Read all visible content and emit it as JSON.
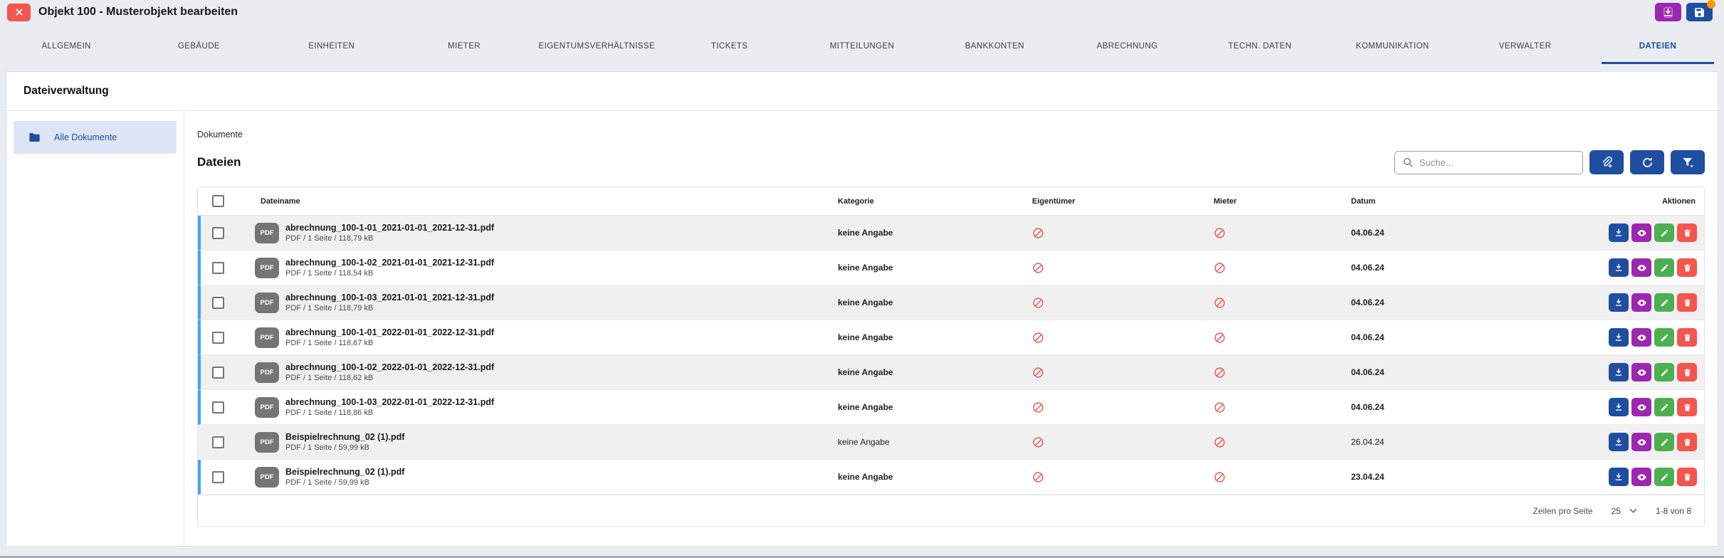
{
  "window": {
    "title": "Objekt 100 - Musterobjekt bearbeiten"
  },
  "topbar": {
    "buttons": [
      "import",
      "save"
    ],
    "save_has_notification": true
  },
  "tabs": [
    {
      "label": "ALLGEMEIN",
      "active": false
    },
    {
      "label": "GEBÄUDE",
      "active": false
    },
    {
      "label": "EINHEITEN",
      "active": false
    },
    {
      "label": "MIETER",
      "active": false
    },
    {
      "label": "EIGENTUMSVERHÄLTNISSE",
      "active": false
    },
    {
      "label": "TICKETS",
      "active": false
    },
    {
      "label": "MITTEILUNGEN",
      "active": false
    },
    {
      "label": "BANKKONTEN",
      "active": false
    },
    {
      "label": "ABRECHNUNG",
      "active": false
    },
    {
      "label": "TECHN. DATEN",
      "active": false
    },
    {
      "label": "KOMMUNIKATION",
      "active": false
    },
    {
      "label": "VERWALTER",
      "active": false
    },
    {
      "label": "DATEIEN",
      "active": true
    }
  ],
  "page": {
    "title": "Dateiverwaltung"
  },
  "sidebar": {
    "items": [
      {
        "label": "Alle Dokumente",
        "active": true
      }
    ]
  },
  "main": {
    "breadcrumb": "Dokumente",
    "heading": "Dateien",
    "search_placeholder": "Suche...",
    "toolbar_icons": [
      "attach-upload",
      "refresh",
      "filter"
    ]
  },
  "table": {
    "headers": {
      "dateiname": "Dateiname",
      "kategorie": "Kategorie",
      "eigentuemer": "Eigentümer",
      "mieter": "Mieter",
      "datum": "Datum",
      "aktionen": "Aktionen"
    },
    "row_actions": [
      "download",
      "view",
      "edit",
      "delete"
    ],
    "rows": [
      {
        "file_badge": "PDF",
        "filename": "abrechnung_100-1-01_2021-01-01_2021-12-31.pdf",
        "meta": "PDF / 1 Seite / 118,79 kB",
        "kategorie": "keine Angabe",
        "eigentuemer": "none",
        "mieter": "none",
        "datum": "04.06.24",
        "emphasized": true
      },
      {
        "file_badge": "PDF",
        "filename": "abrechnung_100-1-02_2021-01-01_2021-12-31.pdf",
        "meta": "PDF / 1 Seite / 118,54 kB",
        "kategorie": "keine Angabe",
        "eigentuemer": "none",
        "mieter": "none",
        "datum": "04.06.24",
        "emphasized": true
      },
      {
        "file_badge": "PDF",
        "filename": "abrechnung_100-1-03_2021-01-01_2021-12-31.pdf",
        "meta": "PDF / 1 Seite / 118,79 kB",
        "kategorie": "keine Angabe",
        "eigentuemer": "none",
        "mieter": "none",
        "datum": "04.06.24",
        "emphasized": true
      },
      {
        "file_badge": "PDF",
        "filename": "abrechnung_100-1-01_2022-01-01_2022-12-31.pdf",
        "meta": "PDF / 1 Seite / 118,67 kB",
        "kategorie": "keine Angabe",
        "eigentuemer": "none",
        "mieter": "none",
        "datum": "04.06.24",
        "emphasized": true
      },
      {
        "file_badge": "PDF",
        "filename": "abrechnung_100-1-02_2022-01-01_2022-12-31.pdf",
        "meta": "PDF / 1 Seite / 118,62 kB",
        "kategorie": "keine Angabe",
        "eigentuemer": "none",
        "mieter": "none",
        "datum": "04.06.24",
        "emphasized": true
      },
      {
        "file_badge": "PDF",
        "filename": "abrechnung_100-1-03_2022-01-01_2022-12-31.pdf",
        "meta": "PDF / 1 Seite / 118,86 kB",
        "kategorie": "keine Angabe",
        "eigentuemer": "none",
        "mieter": "none",
        "datum": "04.06.24",
        "emphasized": true
      },
      {
        "file_badge": "PDF",
        "filename": "Beispielrechnung_02 (1).pdf",
        "meta": "PDF / 1 Seite / 59,99 kB",
        "kategorie": "keine Angabe",
        "eigentuemer": "none",
        "mieter": "none",
        "datum": "26.04.24",
        "emphasized": false
      },
      {
        "file_badge": "PDF",
        "filename": "Beispielrechnung_02 (1).pdf",
        "meta": "PDF / 1 Seite / 59,99 kB",
        "kategorie": "keine Angabe",
        "eigentuemer": "none",
        "mieter": "none",
        "datum": "23.04.24",
        "emphasized": true
      }
    ],
    "footer": {
      "rows_per_page_label": "Zeilen pro Seite",
      "rows_per_page_value": "25",
      "range": "1-8 von 8"
    }
  },
  "colors": {
    "brand_blue": "#1f4ea1",
    "accent_purple": "#9c27b0",
    "accent_green": "#4caf50",
    "accent_red": "#f4554c",
    "row_highlight_blue": "#42a5f5",
    "badge_orange": "#ff9800",
    "pdf_icon_gray": "#757575",
    "ban_icon_red": "#ef5350"
  }
}
